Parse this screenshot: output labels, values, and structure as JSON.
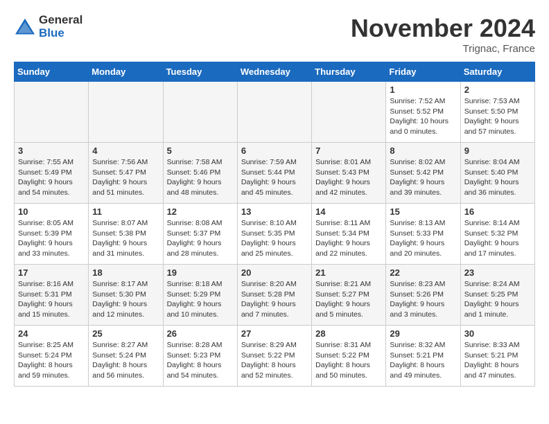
{
  "logo": {
    "general": "General",
    "blue": "Blue"
  },
  "title": "November 2024",
  "location": "Trignac, France",
  "days_of_week": [
    "Sunday",
    "Monday",
    "Tuesday",
    "Wednesday",
    "Thursday",
    "Friday",
    "Saturday"
  ],
  "weeks": [
    [
      {
        "num": "",
        "empty": true
      },
      {
        "num": "",
        "empty": true
      },
      {
        "num": "",
        "empty": true
      },
      {
        "num": "",
        "empty": true
      },
      {
        "num": "",
        "empty": true
      },
      {
        "num": "1",
        "sunrise": "7:52 AM",
        "sunset": "5:52 PM",
        "daylight": "10 hours and 0 minutes."
      },
      {
        "num": "2",
        "sunrise": "7:53 AM",
        "sunset": "5:50 PM",
        "daylight": "9 hours and 57 minutes."
      }
    ],
    [
      {
        "num": "3",
        "sunrise": "7:55 AM",
        "sunset": "5:49 PM",
        "daylight": "9 hours and 54 minutes."
      },
      {
        "num": "4",
        "sunrise": "7:56 AM",
        "sunset": "5:47 PM",
        "daylight": "9 hours and 51 minutes."
      },
      {
        "num": "5",
        "sunrise": "7:58 AM",
        "sunset": "5:46 PM",
        "daylight": "9 hours and 48 minutes."
      },
      {
        "num": "6",
        "sunrise": "7:59 AM",
        "sunset": "5:44 PM",
        "daylight": "9 hours and 45 minutes."
      },
      {
        "num": "7",
        "sunrise": "8:01 AM",
        "sunset": "5:43 PM",
        "daylight": "9 hours and 42 minutes."
      },
      {
        "num": "8",
        "sunrise": "8:02 AM",
        "sunset": "5:42 PM",
        "daylight": "9 hours and 39 minutes."
      },
      {
        "num": "9",
        "sunrise": "8:04 AM",
        "sunset": "5:40 PM",
        "daylight": "9 hours and 36 minutes."
      }
    ],
    [
      {
        "num": "10",
        "sunrise": "8:05 AM",
        "sunset": "5:39 PM",
        "daylight": "9 hours and 33 minutes."
      },
      {
        "num": "11",
        "sunrise": "8:07 AM",
        "sunset": "5:38 PM",
        "daylight": "9 hours and 31 minutes."
      },
      {
        "num": "12",
        "sunrise": "8:08 AM",
        "sunset": "5:37 PM",
        "daylight": "9 hours and 28 minutes."
      },
      {
        "num": "13",
        "sunrise": "8:10 AM",
        "sunset": "5:35 PM",
        "daylight": "9 hours and 25 minutes."
      },
      {
        "num": "14",
        "sunrise": "8:11 AM",
        "sunset": "5:34 PM",
        "daylight": "9 hours and 22 minutes."
      },
      {
        "num": "15",
        "sunrise": "8:13 AM",
        "sunset": "5:33 PM",
        "daylight": "9 hours and 20 minutes."
      },
      {
        "num": "16",
        "sunrise": "8:14 AM",
        "sunset": "5:32 PM",
        "daylight": "9 hours and 17 minutes."
      }
    ],
    [
      {
        "num": "17",
        "sunrise": "8:16 AM",
        "sunset": "5:31 PM",
        "daylight": "9 hours and 15 minutes."
      },
      {
        "num": "18",
        "sunrise": "8:17 AM",
        "sunset": "5:30 PM",
        "daylight": "9 hours and 12 minutes."
      },
      {
        "num": "19",
        "sunrise": "8:18 AM",
        "sunset": "5:29 PM",
        "daylight": "9 hours and 10 minutes."
      },
      {
        "num": "20",
        "sunrise": "8:20 AM",
        "sunset": "5:28 PM",
        "daylight": "9 hours and 7 minutes."
      },
      {
        "num": "21",
        "sunrise": "8:21 AM",
        "sunset": "5:27 PM",
        "daylight": "9 hours and 5 minutes."
      },
      {
        "num": "22",
        "sunrise": "8:23 AM",
        "sunset": "5:26 PM",
        "daylight": "9 hours and 3 minutes."
      },
      {
        "num": "23",
        "sunrise": "8:24 AM",
        "sunset": "5:25 PM",
        "daylight": "9 hours and 1 minute."
      }
    ],
    [
      {
        "num": "24",
        "sunrise": "8:25 AM",
        "sunset": "5:24 PM",
        "daylight": "8 hours and 59 minutes."
      },
      {
        "num": "25",
        "sunrise": "8:27 AM",
        "sunset": "5:24 PM",
        "daylight": "8 hours and 56 minutes."
      },
      {
        "num": "26",
        "sunrise": "8:28 AM",
        "sunset": "5:23 PM",
        "daylight": "8 hours and 54 minutes."
      },
      {
        "num": "27",
        "sunrise": "8:29 AM",
        "sunset": "5:22 PM",
        "daylight": "8 hours and 52 minutes."
      },
      {
        "num": "28",
        "sunrise": "8:31 AM",
        "sunset": "5:22 PM",
        "daylight": "8 hours and 50 minutes."
      },
      {
        "num": "29",
        "sunrise": "8:32 AM",
        "sunset": "5:21 PM",
        "daylight": "8 hours and 49 minutes."
      },
      {
        "num": "30",
        "sunrise": "8:33 AM",
        "sunset": "5:21 PM",
        "daylight": "8 hours and 47 minutes."
      }
    ]
  ]
}
